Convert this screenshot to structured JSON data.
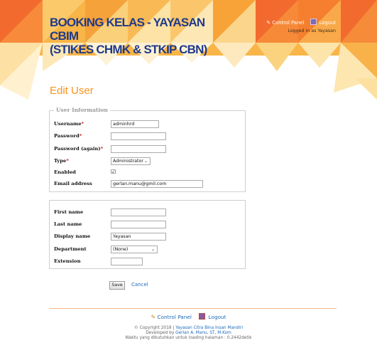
{
  "header": {
    "title_line1": "BOOKING KELAS - YAYASAN",
    "title_line2": "CBIM",
    "title_line3": "(STIKES CHMK & STKIP CBN)",
    "control_panel": "Control Panel",
    "logout": "Logout",
    "logged_in": "Logged in as Yayasan"
  },
  "page": {
    "title": "Edit User"
  },
  "form": {
    "legend": "User Information",
    "username": {
      "label": "Username",
      "required": "*",
      "value": "adminhrd"
    },
    "password": {
      "label": "Password",
      "required": "*",
      "value": ""
    },
    "password_again": {
      "label": "Password (again)",
      "required": "*",
      "value": ""
    },
    "type": {
      "label": "Type",
      "required": "*",
      "value": "Administrator"
    },
    "enabled": {
      "label": "Enabled",
      "checked": true
    },
    "email": {
      "label": "Email address",
      "value": "gerlan.manu@gmil.com"
    },
    "first_name": {
      "label": "First name",
      "value": ""
    },
    "last_name": {
      "label": "Last name",
      "value": ""
    },
    "display_name": {
      "label": "Display name",
      "value": "Yayasan"
    },
    "department": {
      "label": "Department",
      "value": "(None)"
    },
    "extension": {
      "label": "Extension",
      "value": ""
    },
    "save_label": "Save",
    "cancel_label": "Cancel"
  },
  "footer": {
    "control_panel": "Control Panel",
    "logout": "Logout",
    "copyright_prefix": "© Copyright 2018 | ",
    "copyright_link": "Yayasan Citra Bina Insan Mandiri",
    "developed_prefix": "Developed by ",
    "developer_link": "Gerlan A. Manu, ST, M.Kom",
    "loading_time": "Waktu yang dibutuhkan untuk loading halaman : 0.2442detik"
  },
  "colors": {
    "accent_orange": "#f7931e",
    "title_blue": "#1f3a8a",
    "link_blue": "#1e6bb8",
    "required_red": "#d01010"
  }
}
